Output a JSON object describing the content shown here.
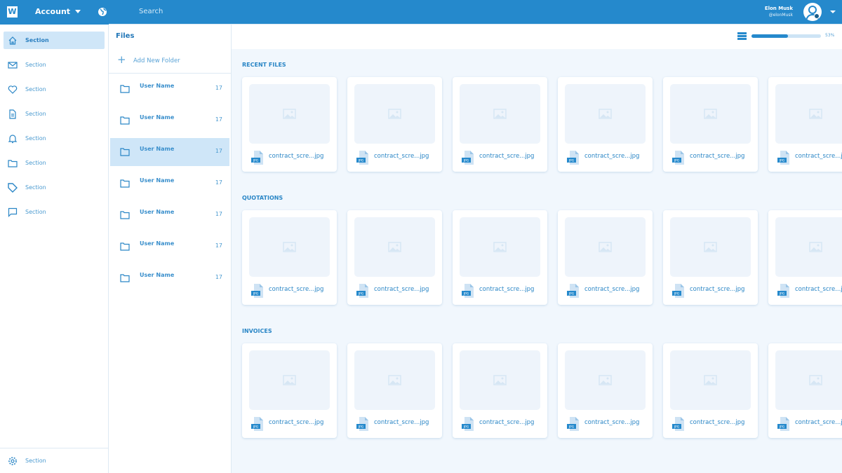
{
  "header": {
    "logo": "W",
    "account": "Account",
    "search_placeholder": "Search",
    "user_name": "Elon Musk",
    "user_handle": "@elonMusk"
  },
  "sidebar": {
    "items": [
      {
        "label": "Section",
        "icon": "home-icon",
        "active": true
      },
      {
        "label": "Section",
        "icon": "mail-icon"
      },
      {
        "label": "Section",
        "icon": "heart-icon"
      },
      {
        "label": "Section",
        "icon": "document-icon"
      },
      {
        "label": "Section",
        "icon": "bell-icon"
      },
      {
        "label": "Section",
        "icon": "folder-icon"
      },
      {
        "label": "Section",
        "icon": "tag-icon"
      },
      {
        "label": "Section",
        "icon": "chat-icon"
      }
    ],
    "footer": {
      "label": "Section",
      "icon": "gear-icon"
    }
  },
  "files": {
    "title": "Files",
    "add_folder": "Add New Folder",
    "storage_percent": 53,
    "storage_label": "53%",
    "folders": [
      {
        "name": "User Name",
        "count": "17"
      },
      {
        "name": "User Name",
        "count": "17"
      },
      {
        "name": "User Name",
        "count": "17",
        "active": true
      },
      {
        "name": "User Name",
        "count": "17"
      },
      {
        "name": "User Name",
        "count": "17"
      },
      {
        "name": "User Name",
        "count": "17"
      },
      {
        "name": "User Name",
        "count": "17"
      }
    ]
  },
  "sections": [
    {
      "title": "RECENT FILES",
      "files": [
        "contract_scre...jpg",
        "contract_scre...jpg",
        "contract_scre...jpg",
        "contract_scre...jpg",
        "contract_scre...jpg",
        "contract_scre...jpg"
      ]
    },
    {
      "title": "QUOTATIONS",
      "files": [
        "contract_scre...jpg",
        "contract_scre...jpg",
        "contract_scre...jpg",
        "contract_scre...jpg",
        "contract_scre...jpg",
        "contract_scre...jpg"
      ]
    },
    {
      "title": "INVOICES",
      "files": [
        "contract_scre...jpg",
        "contract_scre...jpg",
        "contract_scre...jpg",
        "contract_scre...jpg",
        "contract_scre...jpg",
        "contract_scre...jpg"
      ]
    }
  ],
  "file_type_badge": "JPG",
  "colors": {
    "brand": "#2589cc",
    "active_bg": "#cfe6f8",
    "content_bg": "#f1f7fd"
  }
}
